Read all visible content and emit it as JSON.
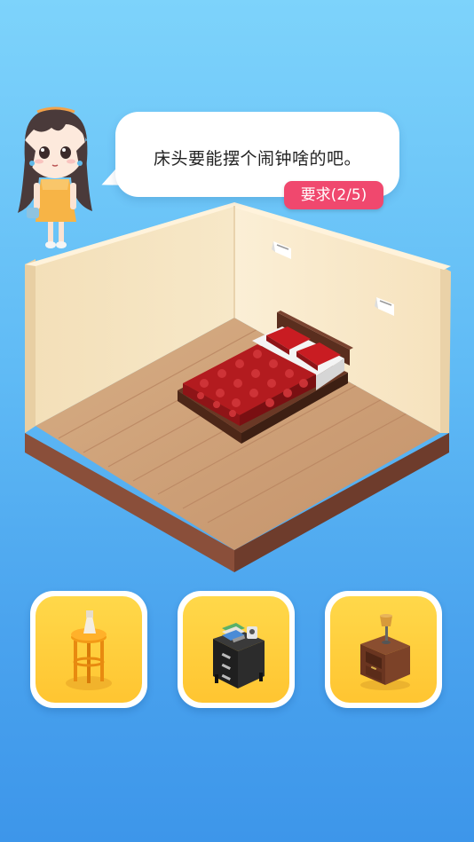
{
  "dialog": {
    "speech": "床头要能摆个闹钟啥的吧。",
    "requirement_badge": "要求(2/5)"
  },
  "options": [
    {
      "icon": "round-side-table-icon"
    },
    {
      "icon": "black-nightstand-icon"
    },
    {
      "icon": "wooden-nightstand-icon"
    }
  ],
  "colors": {
    "option_bg": "#ffc531",
    "badge": "#f0486e",
    "bed_cover": "#b31b1f"
  }
}
